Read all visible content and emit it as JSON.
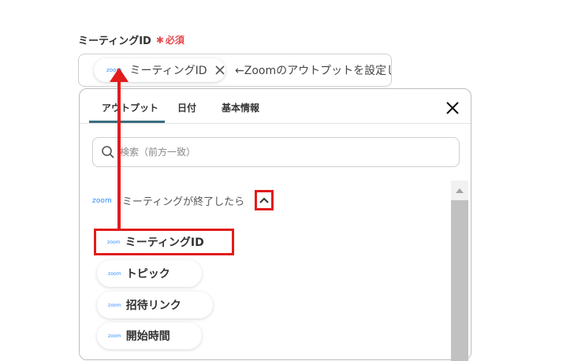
{
  "field": {
    "label": "ミーティングID",
    "required_star": "✱",
    "required_text": "必須",
    "token_logo": "zoom",
    "token_text": "ミーティングID",
    "hint": "←Zoomのアウトプットを設定して"
  },
  "panel": {
    "tabs": [
      {
        "label": "アウトプット",
        "active": true
      },
      {
        "label": "日付",
        "active": false
      },
      {
        "label": "基本情報",
        "active": false
      }
    ],
    "search_placeholder": "検索（前方一致）",
    "group": {
      "logo": "zoom",
      "title": "ミーティングが終了したら",
      "expanded": true
    },
    "items": [
      {
        "logo": "zoom",
        "label": "ミーティングID",
        "highlighted": true
      },
      {
        "logo": "zoom",
        "label": "トピック",
        "highlighted": false
      },
      {
        "logo": "zoom",
        "label": "招待リンク",
        "highlighted": false
      },
      {
        "logo": "zoom",
        "label": "開始時間",
        "highlighted": false
      }
    ]
  },
  "icons": {
    "close": "close-icon",
    "token_remove": "close-icon",
    "search": "search-icon",
    "chevron": "chevron-up-icon",
    "scroll_up": "arrow-up-icon"
  },
  "colors": {
    "accent_underline": "#3b6d80",
    "required": "#e5484d",
    "zoom_blue": "#2d8cff",
    "annotation_red": "#e21b1b"
  }
}
